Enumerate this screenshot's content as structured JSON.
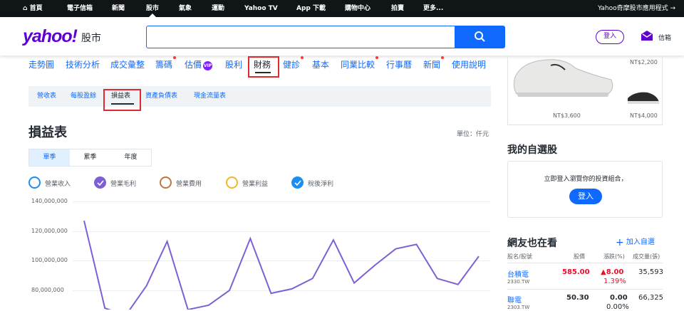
{
  "topnav": {
    "home": "首頁",
    "items": [
      "電子信箱",
      "新聞",
      "股市",
      "氣象",
      "運動",
      "Yahoo TV",
      "App 下載",
      "購物中心",
      "拍賣",
      "更多..."
    ],
    "right_link": "Yahoo奇摩股市應用程式 →"
  },
  "header": {
    "logo_text": "yahoo!",
    "logo_sub": "股市",
    "search_value": "",
    "login_label": "登入",
    "mail_label": "信箱"
  },
  "tabs": [
    {
      "label": "走勢圖",
      "dot": false,
      "vip": false
    },
    {
      "label": "技術分析",
      "dot": false,
      "vip": false
    },
    {
      "label": "成交彙整",
      "dot": false,
      "vip": false
    },
    {
      "label": "籌碼",
      "dot": true,
      "vip": false
    },
    {
      "label": "估價",
      "dot": false,
      "vip": true
    },
    {
      "label": "股利",
      "dot": false,
      "vip": false
    },
    {
      "label": "財務",
      "dot": false,
      "vip": false
    },
    {
      "label": "健診",
      "dot": true,
      "vip": false
    },
    {
      "label": "基本",
      "dot": false,
      "vip": false
    },
    {
      "label": "同業比較",
      "dot": true,
      "vip": false
    },
    {
      "label": "行事曆",
      "dot": false,
      "vip": false
    },
    {
      "label": "新聞",
      "dot": true,
      "vip": false
    },
    {
      "label": "使用說明",
      "dot": false,
      "vip": false
    }
  ],
  "vip_badge": "VIP",
  "subnav": [
    "營收表",
    "每股盈餘",
    "損益表",
    "資產負債表",
    "現金流量表"
  ],
  "page": {
    "title": "損益表",
    "unit": "單位：仟元",
    "period_options": [
      "單季",
      "累季",
      "年度"
    ]
  },
  "colors": {
    "accent": "#0f69ff",
    "brand": "#5f01d1",
    "up": "#eb0f29",
    "series_line": "#7e5fd6"
  },
  "chart_data": {
    "type": "line",
    "legend": [
      {
        "name": "營業收入",
        "color": "#1a8ef2",
        "checked": false
      },
      {
        "name": "營業毛利",
        "color": "#7e5fd6",
        "checked": true
      },
      {
        "name": "營業費用",
        "color": "#c2753d",
        "checked": false
      },
      {
        "name": "營業利益",
        "color": "#f0b72d",
        "checked": false
      },
      {
        "name": "稅後淨利",
        "color": "#1a8ef2",
        "checked": true
      }
    ],
    "y_ticks": [
      "140,000,000",
      "120,000,000",
      "100,000,000",
      "80,000,000"
    ],
    "ylim": [
      70000000,
      140000000
    ],
    "series": [
      {
        "values": [
          127000000,
          68000000,
          63000000,
          83000000,
          113000000,
          67000000,
          70000000,
          80000000,
          115000000,
          78000000,
          81000000,
          88000000,
          114000000,
          85000000,
          97000000,
          108000000,
          111000000,
          88000000,
          84000000,
          103000000
        ]
      }
    ]
  },
  "ad": {
    "prices": [
      "NT$2,200",
      "NT$3,600",
      "NT$4,000"
    ]
  },
  "watchlist": {
    "title": "我的自選股",
    "text": "立即登入瀏覽你的投資組合，",
    "login": "登入"
  },
  "popular": {
    "title": "網友也在看",
    "add": "加入自選",
    "headers": [
      "股名/股號",
      "股價",
      "漲跌(%)",
      "成交量(張)"
    ],
    "rows": [
      {
        "name": "台積電",
        "code": "2330.TW",
        "price": "585.00",
        "change": "▲8.00",
        "pct": "1.39%",
        "volume": "35,593",
        "up": true
      },
      {
        "name": "聯電",
        "code": "2303.TW",
        "price": "50.30",
        "change": "0.00",
        "pct": "0.00%",
        "volume": "66,325",
        "up": false
      }
    ]
  }
}
